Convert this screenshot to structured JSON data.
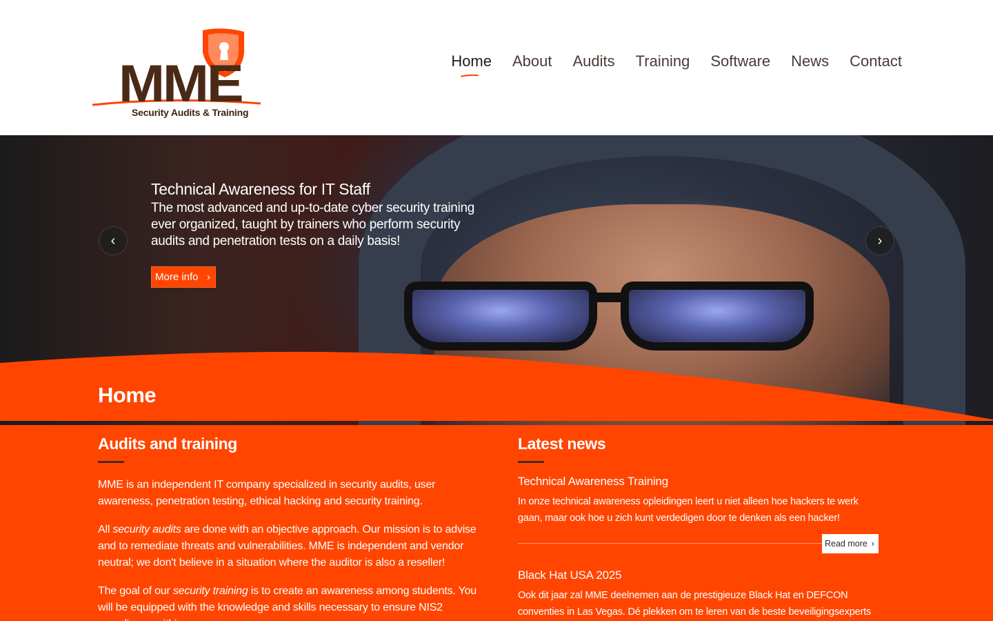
{
  "brand": {
    "logo_text": "MME",
    "tagline": "Security Audits & Training",
    "colors": {
      "accent": "#ff4500",
      "brown": "#4a2a17",
      "white": "#ffffff"
    }
  },
  "nav": {
    "items": [
      {
        "label": "Home",
        "active": true
      },
      {
        "label": "About"
      },
      {
        "label": "Audits"
      },
      {
        "label": "Training"
      },
      {
        "label": "Software"
      },
      {
        "label": "News"
      },
      {
        "label": "Contact"
      }
    ]
  },
  "slider": {
    "title": "Technical Awareness for IT Staff",
    "body": "The most advanced and up-to-date cyber security training ever organized, taught by trainers who perform security audits and penetration tests on a daily basis!",
    "button_label": "More info",
    "button_icon": "chevron-right-icon",
    "prev_icon": "chevron-left-icon",
    "next_icon": "chevron-right-icon"
  },
  "page": {
    "title": "Home"
  },
  "audits": {
    "heading": "Audits and training",
    "p1": "MME is an independent IT company specialized in security audits, user awareness, penetration testing, ethical hacking and security training.",
    "p2_pre": "All ",
    "p2_em": "security audits",
    "p2_post": " are done with an objective approach. Our mission is to advise and to remediate threats and vulnerabilities. MME is independent and vendor neutral; we don't believe in a situation where the auditor is also a reseller!",
    "p3_pre": "The goal of our ",
    "p3_em": "security training",
    "p3_post": " is to create an awareness among students. You will be equipped with the knowledge and skills necessary to ensure NIS2 compliance within your company."
  },
  "news": {
    "heading": "Latest news",
    "items": [
      {
        "title": "Technical Awareness Training",
        "body": "In onze technical awareness opleidingen leert u niet alleen hoe hackers te werk gaan, maar ook hoe u zich kunt verdedigen door te denken als een hacker!",
        "read_more": "Read more"
      },
      {
        "title": "Black Hat USA 2025",
        "body": "Ook dit jaar zal MME deelnemen aan de prestigieuze Black Hat en DEFCON conventies in Las Vegas. Dé plekken om te leren van de beste beveiligingsexperts ter wereld en"
      }
    ]
  }
}
